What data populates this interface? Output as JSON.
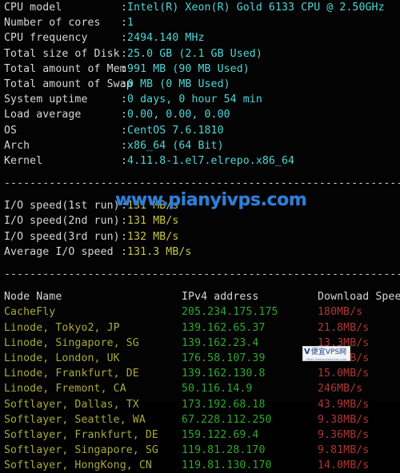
{
  "terminal": {
    "background": "#030303",
    "colors": {
      "label": "#d6d6d6",
      "value_cyan": "#4fd6d6",
      "value_yellow": "#c5c54a",
      "node_olive": "#a9a93c",
      "ip_green": "#2fa82f",
      "speed_red": "#b03535",
      "watermark_blue": "#2f7fd6"
    }
  },
  "system_info": {
    "colon": ":",
    "rows": [
      {
        "label": "CPU model",
        "value": "Intel(R) Xeon(R) Gold 6133 CPU @ 2.50GHz"
      },
      {
        "label": "Number of cores",
        "value": "1"
      },
      {
        "label": "CPU frequency",
        "value": "2494.140 MHz"
      },
      {
        "label": "Total size of Disk",
        "value": "25.0 GB (2.1 GB Used)"
      },
      {
        "label": "Total amount of Mem",
        "value": "991 MB (90 MB Used)"
      },
      {
        "label": "Total amount of Swap",
        "value": "0 MB (0 MB Used)"
      },
      {
        "label": "System uptime",
        "value": "0 days, 0 hour 54 min"
      },
      {
        "label": "Load average",
        "value": "0.00, 0.00, 0.00"
      },
      {
        "label": "OS",
        "value": "CentOS 7.6.1810"
      },
      {
        "label": "Arch",
        "value": "x86_64 (64 Bit)"
      },
      {
        "label": "Kernel",
        "value": "4.11.8-1.el7.elrepo.x86_64"
      }
    ]
  },
  "separator": "----------------------------------------------------------------------",
  "io_speed": {
    "colon": ":",
    "rows": [
      {
        "label": "I/O speed(1st run)",
        "value": "131 MB/s"
      },
      {
        "label": "I/O speed(2nd run)",
        "value": "131 MB/s"
      },
      {
        "label": "I/O speed(3rd run)",
        "value": "132 MB/s"
      },
      {
        "label": "Average I/O speed",
        "value": "131.3 MB/s"
      }
    ]
  },
  "node_table": {
    "headers": {
      "node": "Node Name",
      "ip": "IPv4 address",
      "speed": "Download Speed"
    },
    "rows": [
      {
        "node": "CacheFly",
        "ip": "205.234.175.175",
        "speed": "180MB/s"
      },
      {
        "node": "Linode, Tokyo2, JP",
        "ip": "139.162.65.37",
        "speed": "21.8MB/s"
      },
      {
        "node": "Linode, Singapore, SG",
        "ip": "139.162.23.4",
        "speed": "13.3MB/s"
      },
      {
        "node": "Linode, London, UK",
        "ip": "176.58.107.39",
        "speed": "16.4MB/s"
      },
      {
        "node": "Linode, Frankfurt, DE",
        "ip": "139.162.130.8",
        "speed": "15.0MB/s"
      },
      {
        "node": "Linode, Fremont, CA",
        "ip": "50.116.14.9",
        "speed": "246MB/s"
      },
      {
        "node": "Softlayer, Dallas, TX",
        "ip": "173.192.68.18",
        "speed": "43.9MB/s"
      },
      {
        "node": "Softlayer, Seattle, WA",
        "ip": "67.228.112.250",
        "speed": "9.38MB/s"
      },
      {
        "node": "Softlayer, Frankfurt, DE",
        "ip": "159.122.69.4",
        "speed": "9.36MB/s"
      },
      {
        "node": "Softlayer, Singapore, SG",
        "ip": "119.81.28.170",
        "speed": "9.81MB/s"
      },
      {
        "node": "Softlayer, HongKong, CN",
        "ip": "119.81.130.170",
        "speed": "14.0MB/s"
      }
    ]
  },
  "watermark": {
    "text": "www.pianyivps.com"
  },
  "badge": {
    "mark": "V",
    "title": "便宜VPS网",
    "url": "https://www.pianyivps.com"
  }
}
